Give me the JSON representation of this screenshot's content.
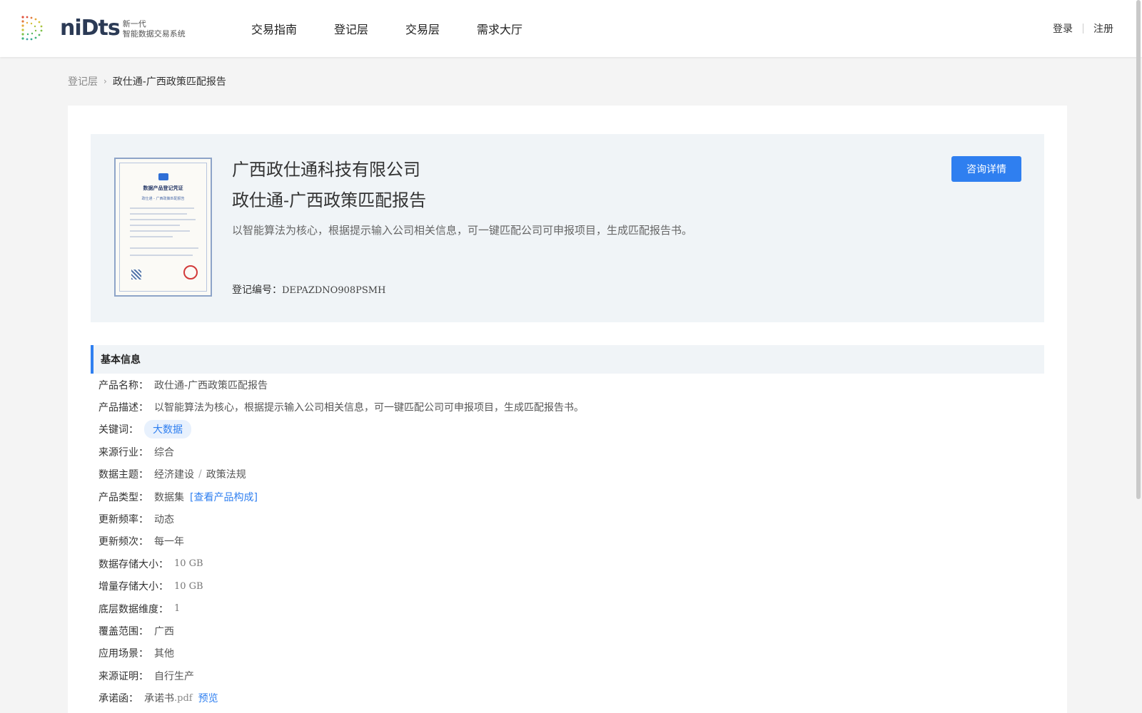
{
  "header": {
    "logo_word": "niDts",
    "logo_sub1": "新一代",
    "logo_sub2": "智能数据交易系统",
    "nav": [
      "交易指南",
      "登记层",
      "交易层",
      "需求大厅"
    ],
    "login": "登录",
    "register": "注册"
  },
  "breadcrumb": {
    "parent": "登记层",
    "current": "政仕通-广西政策匹配报告"
  },
  "hero": {
    "company": "广西政仕通科技有限公司",
    "product": "政仕通-广西政策匹配报告",
    "description": "以智能算法为核心，根据提示输入公司相关信息，可一键匹配公司可申报项目，生成匹配报告书。",
    "reg_label": "登记编号：",
    "reg_value": "DEPAZDNO908PSMH",
    "consult_button": "咨询详情",
    "certificate": {
      "title": "数据产品登记凭证",
      "subtitle": "政仕通 - 广西政策匹配报告"
    }
  },
  "basic_info": {
    "title": "基本信息",
    "product_name": {
      "label": "产品名称：",
      "value": "政仕通-广西政策匹配报告"
    },
    "product_desc": {
      "label": "产品描述：",
      "value": "以智能算法为核心，根据提示输入公司相关信息，可一键匹配公司可申报项目，生成匹配报告书。"
    },
    "keywords": {
      "label": "关键词：",
      "value": "大数据"
    },
    "source_industry": {
      "label": "来源行业：",
      "value": "综合"
    },
    "data_theme": {
      "label": "数据主题：",
      "value1": "经济建设",
      "sep": "/",
      "value2": "政策法规"
    },
    "product_type": {
      "label": "产品类型：",
      "value": "数据集",
      "link": "[查看产品构成]"
    },
    "update_rate": {
      "label": "更新频率：",
      "value": "动态"
    },
    "update_freq": {
      "label": "更新频次：",
      "value": "每一年"
    },
    "storage_size": {
      "label": "数据存储大小：",
      "value": "10 GB"
    },
    "incr_size": {
      "label": "增量存储大小：",
      "value": "10 GB"
    },
    "dimension": {
      "label": "底层数据维度：",
      "value": "1"
    },
    "coverage": {
      "label": "覆盖范围：",
      "value": "广西"
    },
    "scenario": {
      "label": "应用场景：",
      "value": "其他"
    },
    "source_proof": {
      "label": "来源证明：",
      "value": "自行生产"
    },
    "commitment": {
      "label": "承诺函：",
      "value": "承诺书",
      "ext": ".pdf",
      "link": "预览"
    }
  },
  "colors": {
    "accent": "#2f7ff0",
    "hero_bg": "#f0f4f7",
    "page_bg": "#f4f4f4"
  }
}
